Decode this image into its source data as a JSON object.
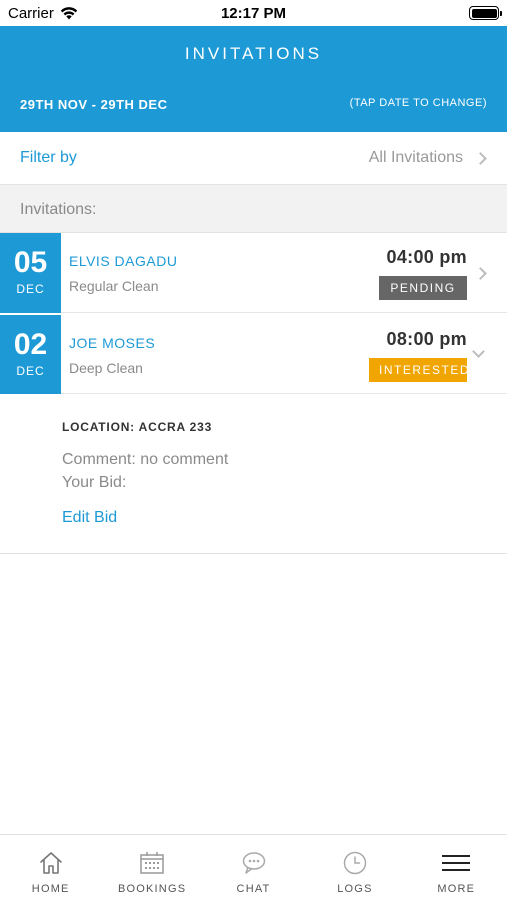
{
  "status_bar": {
    "carrier": "Carrier",
    "time": "12:17 PM"
  },
  "header": {
    "title": "INVITATIONS",
    "date_range": "29TH NOV - 29TH DEC",
    "date_hint": "(TAP DATE TO CHANGE)"
  },
  "filter": {
    "label": "Filter by",
    "value": "All Invitations"
  },
  "section_title": "Invitations:",
  "invitations": [
    {
      "day": "05",
      "month": "DEC",
      "name": "ELVIS DAGADU",
      "service": "Regular Clean",
      "time": "04:00 pm",
      "status": "PENDING",
      "status_color": "#666666"
    },
    {
      "day": "02",
      "month": "DEC",
      "name": "JOE MOSES",
      "service": "Deep Clean",
      "time": "08:00 pm",
      "status": "INTERESTED",
      "status_color": "#f0a500"
    }
  ],
  "detail": {
    "location": "LOCATION: ACCRA 233",
    "comment": "Comment: no comment",
    "bid": "Your Bid:",
    "edit_bid": "Edit Bid"
  },
  "tabs": [
    {
      "label": "HOME",
      "icon": "home-icon"
    },
    {
      "label": "BOOKINGS",
      "icon": "calendar-icon"
    },
    {
      "label": "CHAT",
      "icon": "chat-icon"
    },
    {
      "label": "LOGS",
      "icon": "clock-icon"
    },
    {
      "label": "MORE",
      "icon": "menu-icon"
    }
  ],
  "colors": {
    "brand": "#1d9ad6",
    "pending": "#666666",
    "interested": "#f0a500"
  }
}
